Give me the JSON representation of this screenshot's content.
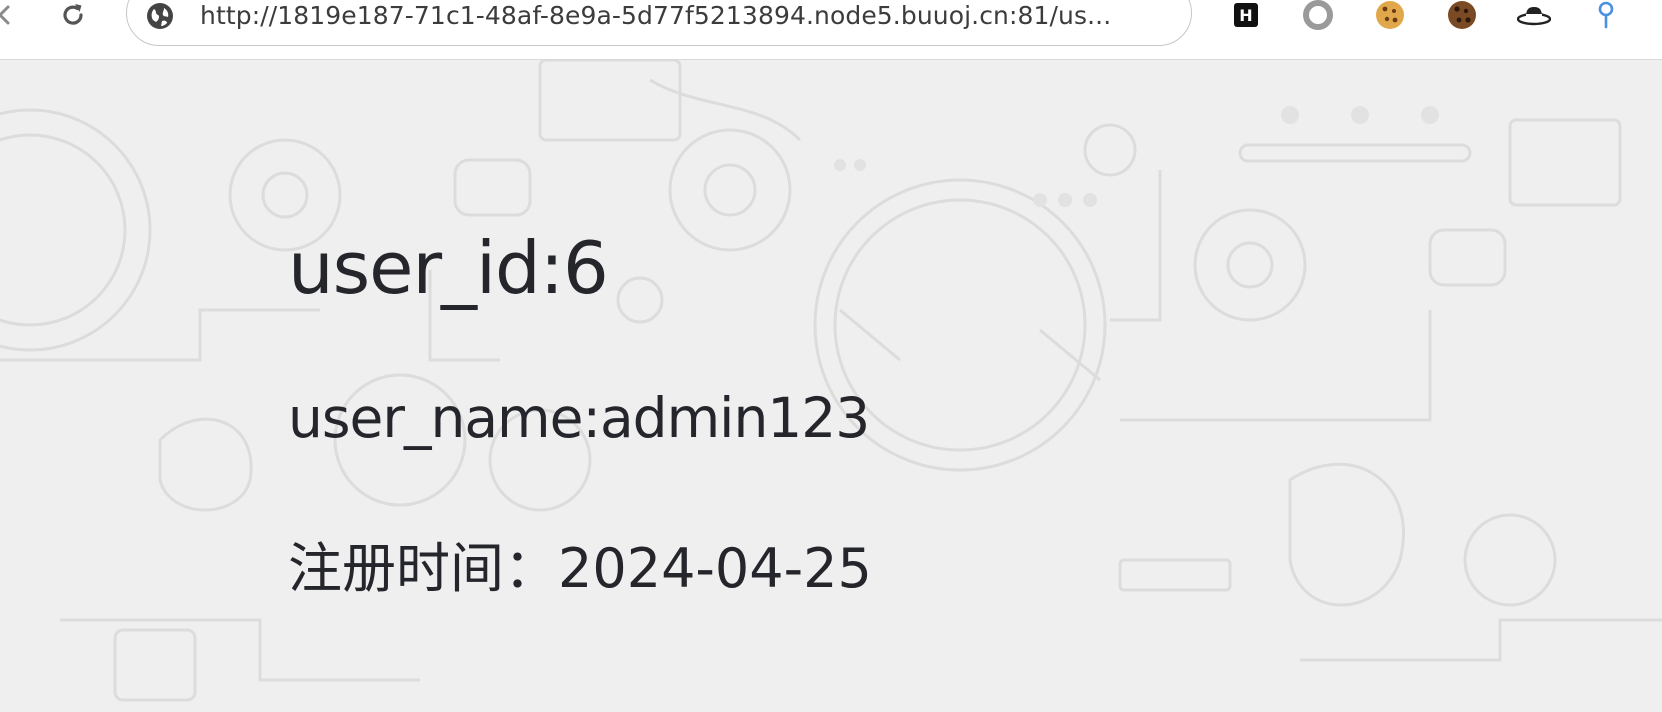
{
  "browser": {
    "url": "http://1819e187-71c1-48af-8e9a-5d77f5213894.node5.buuoj.cn:81/us...",
    "icons": {
      "back": "back-arrow-icon",
      "reload": "reload-icon",
      "site": "globe-icon"
    },
    "extensions": [
      {
        "icon": "h-letter-icon",
        "letter": "H"
      },
      {
        "icon": "ring-icon"
      },
      {
        "icon": "cookie-icon"
      },
      {
        "icon": "cookie-dark-icon"
      },
      {
        "icon": "hat-icon"
      },
      {
        "icon": "pin-icon"
      }
    ]
  },
  "page": {
    "user_id_line": "user_id:6",
    "user_name_line": "user_name:admin123",
    "register_line": "注册时间：2024-04-25"
  },
  "colors": {
    "page_background": "#efefef",
    "text": "#24262b",
    "background_art": "#dcdcdc",
    "pin_blue": "#4a90e2"
  }
}
